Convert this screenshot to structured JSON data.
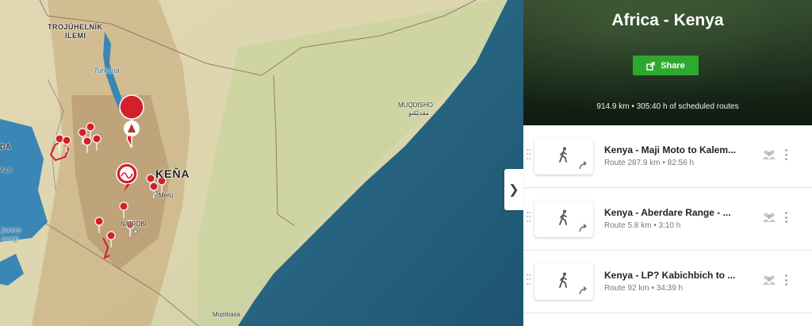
{
  "map": {
    "labels": {
      "trojuhelnik": "TROJÚHELNÍK",
      "ilemi": "ILEMI",
      "turkana": "Turkana",
      "mogadishu": "MUQDISHO",
      "mogadishu_ar": "مقديشو",
      "kena": "KEŇA",
      "meru": "Meru",
      "nairobi": "NAIROBI",
      "mombasa": "Mombasa",
      "lake_victoria": "jezero",
      "lake_victoria2": "ewej)",
      "da": "DA",
      "ala": "ALA"
    },
    "colors": {
      "sea": "#1f5b78",
      "land": "#d9ceac",
      "marker": "#d3202a"
    },
    "icons": [
      "camp-marker-icon",
      "route-marker-icon",
      "pin-marker-icon"
    ]
  },
  "panel_toggle": {
    "icon": "chevron-right-icon",
    "glyph": "❯"
  },
  "header": {
    "title": "Africa - Kenya",
    "share_label": "Share",
    "summary": "914.9 km • 305:40 h of scheduled routes"
  },
  "routes": [
    {
      "name": "Kenya - Maji Moto to Kalem...",
      "meta": "Route 287.9 km • 82:56 h",
      "icon": "hiking-icon"
    },
    {
      "name": "Kenya - Aberdare Range - ...",
      "meta": "Route 5.8 km • 3:10 h",
      "icon": "hiking-icon"
    },
    {
      "name": "Kenya - LP? Kabichbich to ...",
      "meta": "Route 92 km • 34:39 h",
      "icon": "hiking-icon"
    }
  ]
}
